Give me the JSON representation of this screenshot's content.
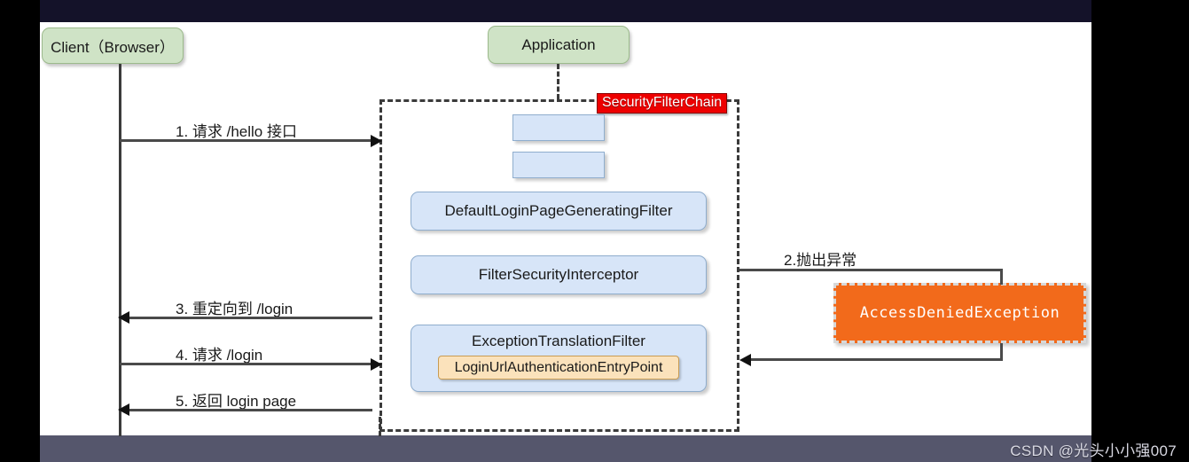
{
  "diagram": {
    "actors": [
      {
        "id": "client",
        "label": "Client（Browser）"
      },
      {
        "id": "application",
        "label": "Application"
      }
    ],
    "chain": {
      "label": "SecurityFilterChain",
      "label_bg": "#ee0000",
      "label_color": "#ffffff"
    },
    "filters": [
      {
        "id": "empty-1",
        "label": ""
      },
      {
        "id": "empty-2",
        "label": ""
      },
      {
        "id": "default-login-page-generating-filter",
        "label": "DefaultLoginPageGeneratingFilter"
      },
      {
        "id": "filter-security-interceptor",
        "label": "FilterSecurityInterceptor"
      },
      {
        "id": "exception-translation-filter",
        "label": "ExceptionTranslationFilter"
      }
    ],
    "entry_point": {
      "label": "LoginUrlAuthenticationEntryPoint",
      "bg": "#fbe2bb"
    },
    "exception": {
      "label": "AccessDeniedException",
      "bg": "#f26a1b",
      "color": "#ffffff"
    },
    "messages": [
      {
        "num": "1",
        "label": "1. 请求 /hello 接口",
        "direction": "right"
      },
      {
        "num": "2",
        "label": "2.抛出异常",
        "direction": "right"
      },
      {
        "num": "3",
        "label": "3. 重定向到 /login",
        "direction": "left"
      },
      {
        "num": "4",
        "label": "4. 请求 /login",
        "direction": "right"
      },
      {
        "num": "5",
        "label": "5. 返回 login page",
        "direction": "left"
      }
    ]
  },
  "watermark": {
    "text": "CSDN @光头小小强007"
  }
}
